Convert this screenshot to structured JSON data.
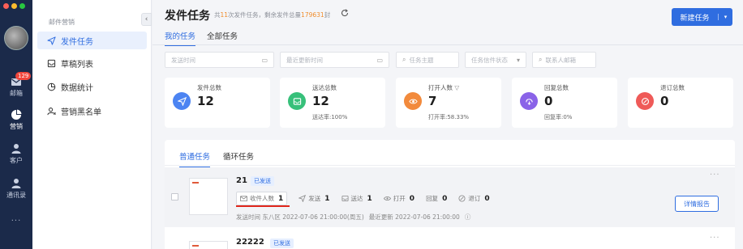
{
  "rail": {
    "badge": "129",
    "items": [
      {
        "label": "邮箱",
        "icon": "mail-icon"
      },
      {
        "label": "营销",
        "icon": "pie-chart-icon"
      },
      {
        "label": "客户",
        "icon": "customer-icon"
      },
      {
        "label": "通讯录",
        "icon": "contacts-icon"
      }
    ],
    "more": "···"
  },
  "sidebar": {
    "section": "邮件营销",
    "collapse": "‹",
    "items": [
      {
        "label": "发件任务",
        "icon": "send-icon"
      },
      {
        "label": "草稿列表",
        "icon": "draft-icon"
      },
      {
        "label": "数据统计",
        "icon": "stats-icon"
      },
      {
        "label": "营销黑名单",
        "icon": "blacklist-icon"
      }
    ]
  },
  "header": {
    "title": "发件任务",
    "sub_a": "共",
    "task_count": "11",
    "sub_b": "次发件任务，剩余发件总量",
    "remaining": "179631",
    "sub_c": "封",
    "new_button": "新建任务",
    "dropdown": "▾"
  },
  "tabs": [
    "我的任务",
    "全部任务"
  ],
  "filters": {
    "send_time": "发送时间",
    "last_update": "最近更新时间",
    "subject": "任务主题",
    "status": "任务信件状态",
    "contact": "联系人邮箱"
  },
  "stats": [
    {
      "label": "发件总数",
      "value": "12",
      "sub": "",
      "color": "#4c84f2"
    },
    {
      "label": "送达总数",
      "value": "12",
      "sub": "送达率:100%",
      "color": "#37c07a"
    },
    {
      "label": "打开人数",
      "value": "7",
      "sub": "打开率:58.33%",
      "color": "#f28a3c"
    },
    {
      "label": "回复总数",
      "value": "0",
      "sub": "回复率:0%",
      "color": "#8a63e8"
    },
    {
      "label": "退订总数",
      "value": "0",
      "sub": "",
      "color": "#ef5a58"
    }
  ],
  "list": {
    "tabs": [
      "普通任务",
      "循环任务"
    ],
    "rows": [
      {
        "name": "21",
        "status": "已发送",
        "metrics": [
          {
            "label": "收件人数",
            "value": "1"
          },
          {
            "label": "发送",
            "value": "1"
          },
          {
            "label": "送达",
            "value": "1"
          },
          {
            "label": "打开",
            "value": "0"
          },
          {
            "label": "回复",
            "value": "0"
          },
          {
            "label": "退订",
            "value": "0"
          }
        ],
        "send_time": "发送时间 东八区 2022-07-06 21:00:00(周五)",
        "last_update": "最近更新 2022-07-06 21:00:00",
        "detail_button": "详情报告",
        "more": "···"
      },
      {
        "name": "22222",
        "status": "已发送",
        "more": "···"
      }
    ]
  }
}
